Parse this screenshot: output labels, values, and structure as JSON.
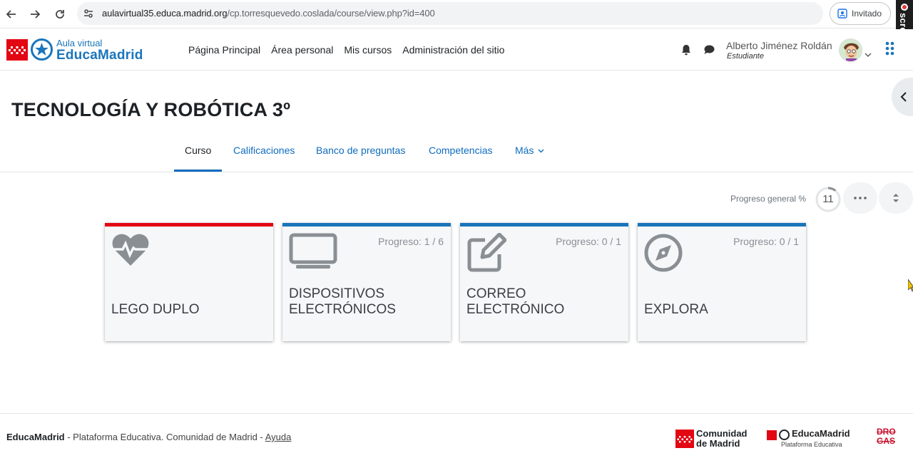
{
  "browser": {
    "url_host": "aulavirtual35.educa.madrid.org",
    "url_path": "/cp.torresquevedo.coslada/course/view.php?id=400",
    "guest_label": "Invitado",
    "screenrec_label": "screenrec"
  },
  "header": {
    "logo_small": "Aula virtual",
    "logo_big": "EducaMadrid",
    "nav": [
      "Página Principal",
      "Área personal",
      "Mis cursos",
      "Administración del sitio"
    ],
    "user_name": "Alberto Jiménez Roldán",
    "user_role": "Estudiante"
  },
  "course": {
    "title": "TECNOLOGÍA Y ROBÓTICA 3º",
    "tabs": [
      "Curso",
      "Calificaciones",
      "Banco de preguntas",
      "Competencias",
      "Más"
    ],
    "active_tab": "Curso",
    "progress_label": "Progreso general %",
    "progress_value": "11"
  },
  "cards": [
    {
      "title": "LEGO DUPLO",
      "progress": "",
      "icon": "heartbeat-icon",
      "accent": "#e30613"
    },
    {
      "title": "DISPOSITIVOS ELECTRÓNICOS",
      "progress": "Progreso: 1 / 6",
      "icon": "monitor-icon",
      "accent": "#1a75bb"
    },
    {
      "title": "CORREO ELECTRÓNICO",
      "progress": "Progreso: 0 / 1",
      "icon": "edit-icon",
      "accent": "#1a75bb"
    },
    {
      "title": "EXPLORA",
      "progress": "Progreso: 0 / 1",
      "icon": "compass-icon",
      "accent": "#1a75bb"
    }
  ],
  "footer": {
    "brand": "EducaMadrid",
    "text": " - Plataforma Educativa. Comunidad de Madrid - ",
    "help": "Ayuda",
    "comunidad_line1": "Comunidad",
    "comunidad_line2": "de Madrid",
    "edu_name": "EducaMadrid",
    "edu_sub": "Plataforma Educativa",
    "drogas_line1": "DRO",
    "drogas_line2": "GAS"
  }
}
